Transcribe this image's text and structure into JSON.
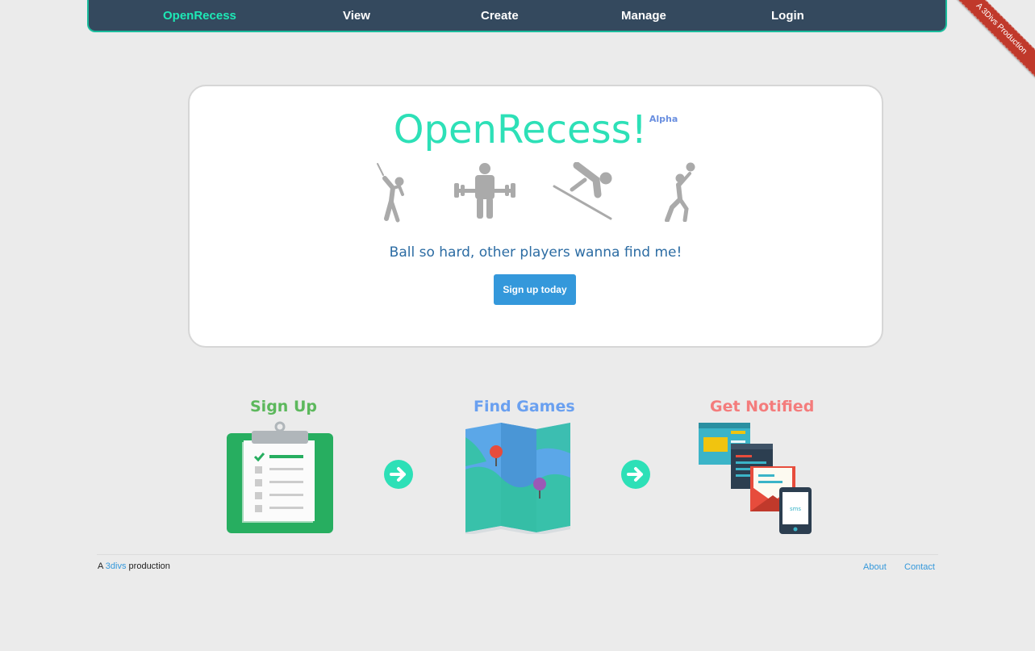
{
  "nav": {
    "brand": "OpenRecess",
    "items": [
      "View",
      "Create",
      "Manage",
      "Login"
    ]
  },
  "ribbon": "A 3Divs Production",
  "hero": {
    "title": "OpenRecess!",
    "badge": "Alpha",
    "tagline": "Ball so hard, other players wanna find me!",
    "cta": "Sign up today",
    "sport_icons": [
      "tennis-player-icon",
      "weightlifter-icon",
      "skier-icon",
      "volleyball-player-icon"
    ]
  },
  "steps": [
    {
      "title": "Sign Up",
      "color": "#5cb85c",
      "icon": "clipboard-icon"
    },
    {
      "title": "Find Games",
      "color": "#6aa0f0",
      "icon": "map-icon"
    },
    {
      "title": "Get Notified",
      "color": "#f47c7c",
      "icon": "notifications-icon"
    }
  ],
  "footer": {
    "prefix": "A",
    "link": "3divs",
    "suffix": "production",
    "links": [
      "About",
      "Contact"
    ]
  },
  "colors": {
    "nav_bg": "#34495e",
    "accent": "#1de9b6",
    "button": "#3498db",
    "ribbon": "#c0392b"
  }
}
